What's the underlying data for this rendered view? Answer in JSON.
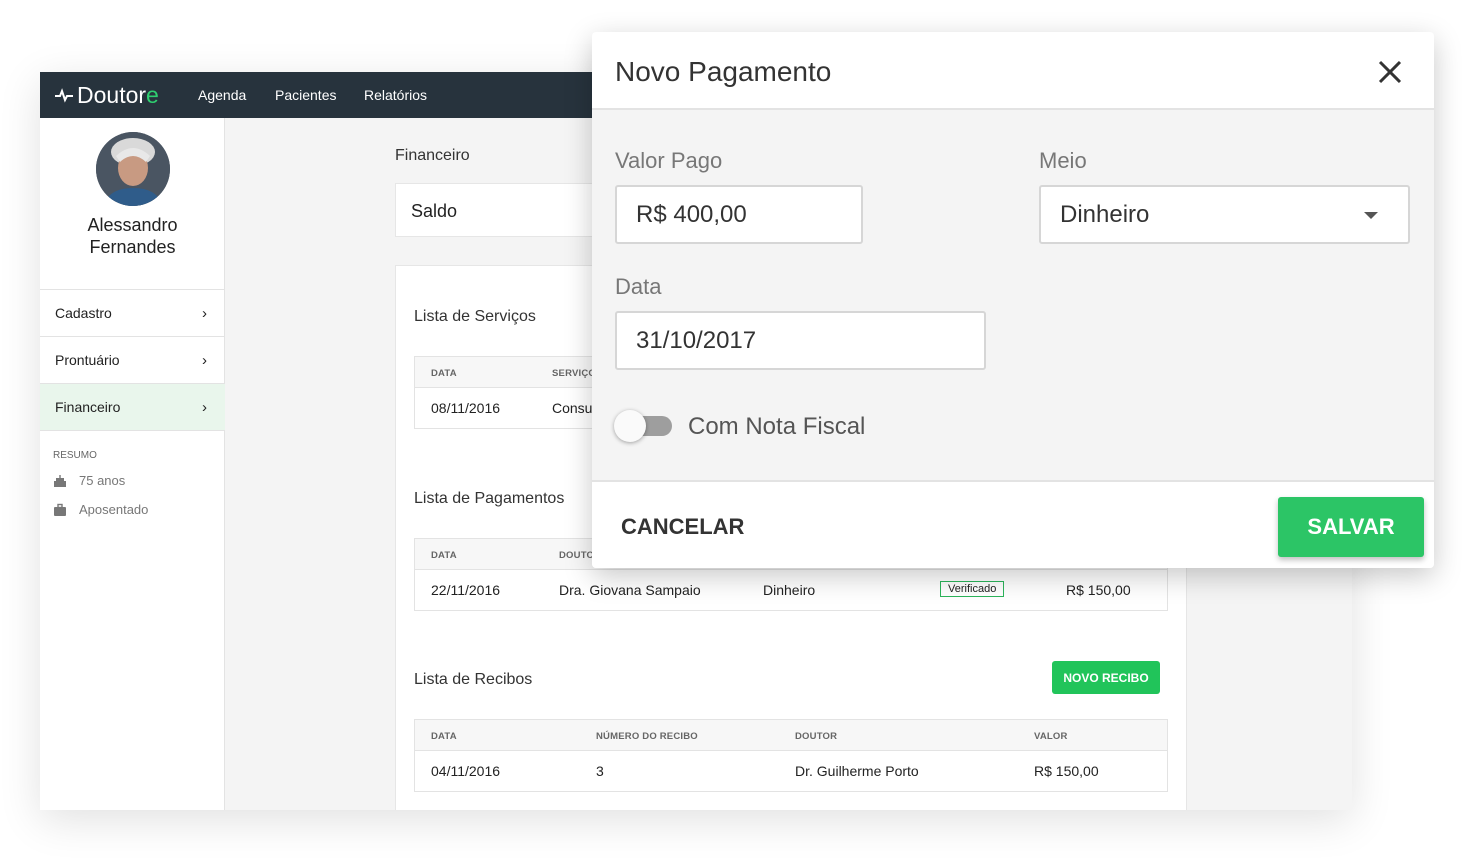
{
  "app": {
    "logo_main": "Doutor",
    "logo_accent": "e",
    "nav": [
      "Agenda",
      "Pacientes",
      "Relatórios"
    ]
  },
  "patient": {
    "name_line1": "Alessandro",
    "name_line2": "Fernandes",
    "menu": [
      "Cadastro",
      "Prontuário",
      "Financeiro"
    ],
    "active_menu": "Financeiro",
    "resumo_title": "RESUMO",
    "age": "75 anos",
    "occupation": "Aposentado"
  },
  "content": {
    "title": "Financeiro",
    "saldo_label": "Saldo",
    "servicos": {
      "title": "Lista de Serviços",
      "headers": [
        "DATA",
        "SERVIÇO"
      ],
      "rows": [
        [
          "08/11/2016",
          "Consulta"
        ]
      ]
    },
    "pagamentos": {
      "title": "Lista de Pagamentos",
      "headers": [
        "DATA",
        "DOUTOR"
      ],
      "rows": [
        [
          "22/11/2016",
          "Dra. Giovana Sampaio",
          "Dinheiro",
          "Verificado",
          "R$ 150,00"
        ]
      ]
    },
    "recibos": {
      "title": "Lista de Recibos",
      "button": "NOVO RECIBO",
      "headers": [
        "DATA",
        "NÚMERO DO RECIBO",
        "DOUTOR",
        "VALOR"
      ],
      "rows": [
        [
          "04/11/2016",
          "3",
          "Dr. Guilherme Porto",
          "R$ 150,00"
        ]
      ]
    }
  },
  "dialog": {
    "title": "Novo Pagamento",
    "valor_label": "Valor Pago",
    "valor_value": "R$ 400,00",
    "meio_label": "Meio",
    "meio_value": "Dinheiro",
    "data_label": "Data",
    "data_value": "31/10/2017",
    "toggle_label": "Com Nota Fiscal",
    "toggle_on": false,
    "cancel": "CANCELAR",
    "save": "SALVAR"
  },
  "colors": {
    "brand_green": "#2cc566",
    "topbar": "#27333d",
    "active_menu_bg": "#e9f6ec"
  }
}
